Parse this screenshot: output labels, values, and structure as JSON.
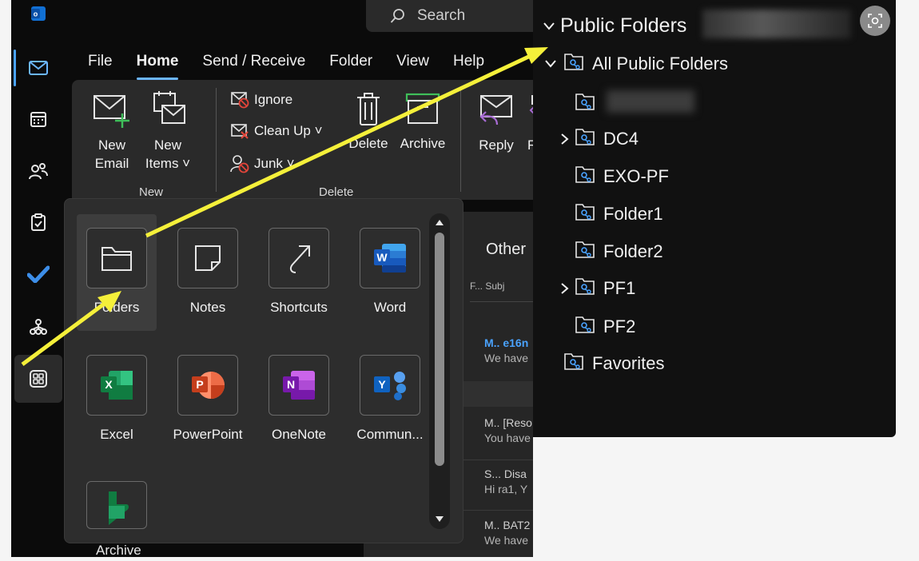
{
  "search": {
    "placeholder": "Search",
    "icon": "search-icon"
  },
  "menu": {
    "items": [
      "File",
      "Home",
      "Send / Receive",
      "Folder",
      "View",
      "Help"
    ],
    "active": "Home"
  },
  "ribbon": {
    "new_email": [
      "New",
      "Email"
    ],
    "new_items": [
      "New",
      "Items ˅"
    ],
    "group_new": "New",
    "ignore": "Ignore",
    "clean_up": "Clean Up ˅",
    "junk": "Junk ˅",
    "delete": "Delete",
    "archive": "Archive",
    "group_delete": "Delete",
    "reply": "Reply",
    "reply_all_partial": "Re"
  },
  "message_list": {
    "tab_other": "Other",
    "col_header": "F...  Subj",
    "rows": [
      {
        "line1": "M.. e16n",
        "line2": "We have"
      },
      {
        "line1": "M.. [Reso",
        "line2": "You have"
      },
      {
        "line1": "S...  Disa",
        "line2": "Hi ra1, Y"
      },
      {
        "line1": "M.. BAT2",
        "line2": "We have"
      }
    ],
    "accent": "#4aa3ff"
  },
  "bottom_label": "Archive",
  "apps_flyout": {
    "tiles": [
      {
        "label": "Folders",
        "icon": "folder-icon"
      },
      {
        "label": "Notes",
        "icon": "note-icon"
      },
      {
        "label": "Shortcuts",
        "icon": "shortcut-arrow-icon"
      },
      {
        "label": "Word",
        "icon": "word-icon"
      },
      {
        "label": "Excel",
        "icon": "excel-icon"
      },
      {
        "label": "PowerPoint",
        "icon": "powerpoint-icon"
      },
      {
        "label": "OneNote",
        "icon": "onenote-icon"
      },
      {
        "label": "Commun...",
        "icon": "yammer-icon"
      },
      {
        "label": "",
        "icon": "bookings-icon"
      }
    ]
  },
  "public_folders": {
    "root": "Public Folders",
    "all": "All Public Folders",
    "items": [
      "DC4",
      "EXO-PF",
      "Folder1",
      "Folder2",
      "PF1",
      "PF2"
    ],
    "favorites": "Favorites"
  },
  "colors": {
    "arrow": "#f5f03a",
    "word": "#2b7cd3",
    "excel": "#1d7d45",
    "powerpoint": "#d24726",
    "onenote": "#7b39c9",
    "yammer": "#3a8de0"
  }
}
